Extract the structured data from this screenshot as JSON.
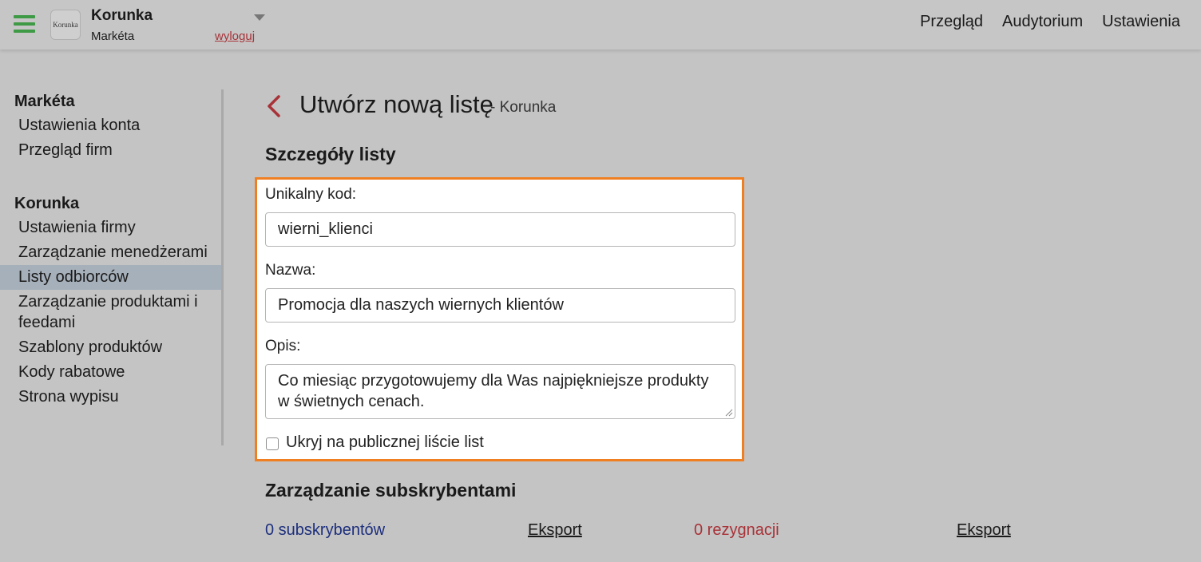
{
  "header": {
    "logo_text": "Korunka",
    "company": "Korunka",
    "user": "Markéta",
    "logout": "wyloguj",
    "accent_color": "#3f9a46",
    "nav": [
      "Przegląd",
      "Audytorium",
      "Ustawienia"
    ]
  },
  "sidebar": {
    "user_heading": "Markéta",
    "user_items": [
      "Ustawienia konta",
      "Przegląd firm"
    ],
    "company_heading": "Korunka",
    "company_items": [
      "Ustawienia firmy",
      "Zarządzanie menedżerami",
      "Listy odbiorców",
      "Zarządzanie produktami i feedami",
      "Szablony produktów",
      "Kody rabatowe",
      "Strona wypisu"
    ],
    "active_item": "Listy odbiorców"
  },
  "main": {
    "title": "Utwórz nową listę",
    "subtitle": "- Korunka",
    "details_title": "Szczegóły listy",
    "code_label": "Unikalny kod:",
    "code_value": "wierni_klienci",
    "name_label": "Nazwa:",
    "name_value": "Promocja dla naszych wiernych klientów",
    "desc_label": "Opis:",
    "desc_value": "Co miesiąc przygotowujemy dla Was najpiękniejsze produkty w świetnych cenach.",
    "hide_label": "Ukryj na publicznej liście list",
    "hide_checked": false,
    "highlight_color": "#f07f21",
    "subs_title": "Zarządzanie subskrybentami",
    "subscribers": "0 subskrybentów",
    "export1": "Eksport",
    "unsubscribes": "0 rezygnacji",
    "export2": "Eksport"
  }
}
